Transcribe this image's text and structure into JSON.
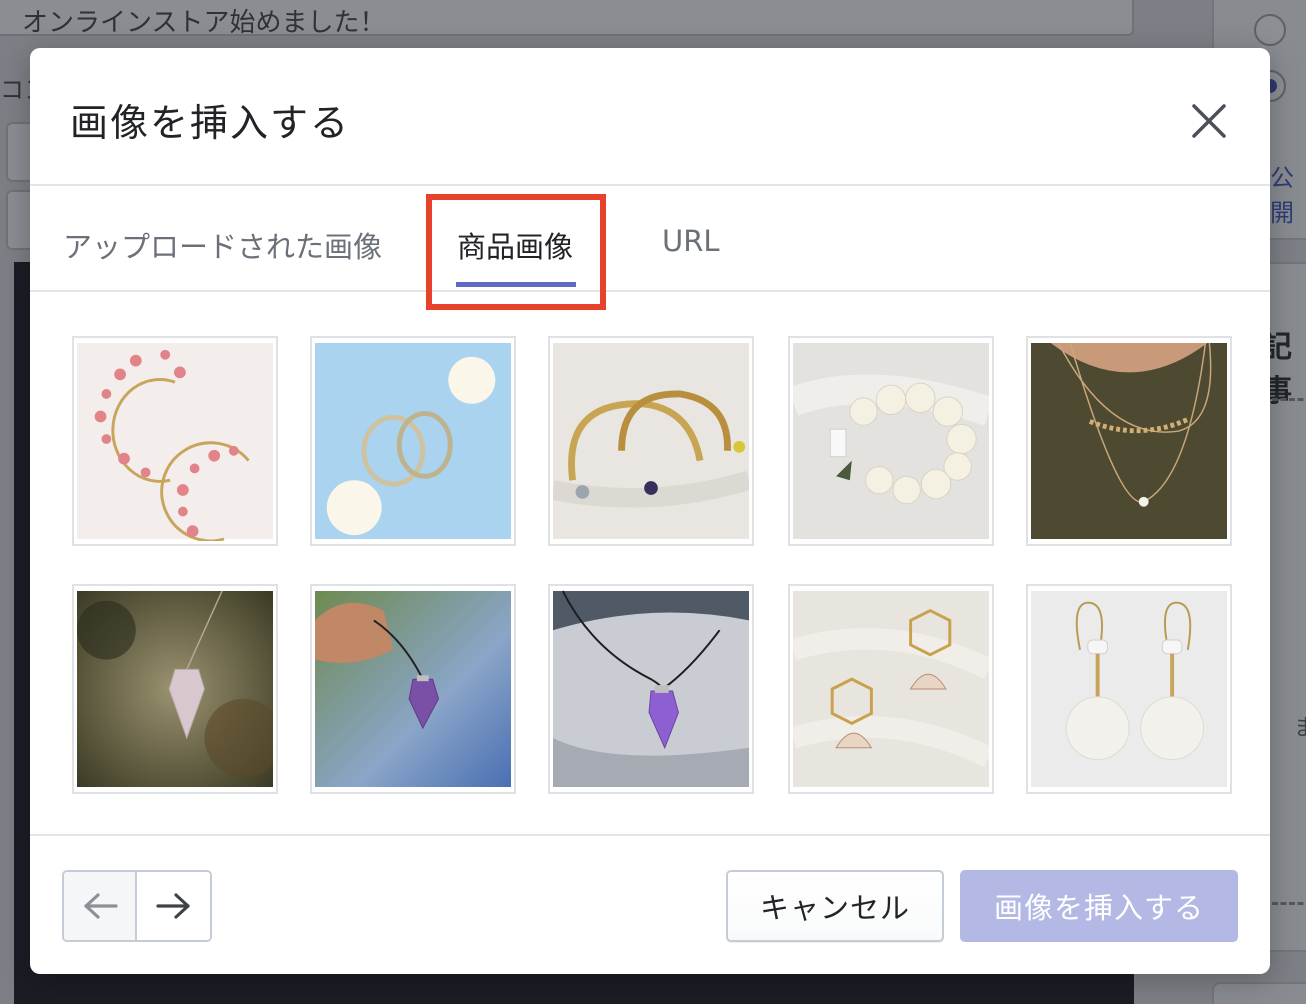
{
  "background": {
    "post_title": "オンラインストア始めました！",
    "content_label": "コン",
    "visibility_link": "公開",
    "article_heading": "記事",
    "side_text": "ま"
  },
  "modal": {
    "title": "画像を挿入する",
    "close_icon": "close-icon",
    "tabs": [
      {
        "label": "アップロードされた画像",
        "active": false
      },
      {
        "label": "商品画像",
        "active": true
      },
      {
        "label": "URL",
        "active": false
      }
    ],
    "highlight_color": "#e8412c",
    "accent_color": "#5c6ac4",
    "images": [
      {
        "name": "pink-flower-hoop-earrings"
      },
      {
        "name": "gold-hoop-earrings-blue-background"
      },
      {
        "name": "gold-cuff-bracelets-with-stones"
      },
      {
        "name": "white-bead-bracelet"
      },
      {
        "name": "layered-gold-necklace"
      },
      {
        "name": "crystal-pendulum"
      },
      {
        "name": "amethyst-pendant-in-hand"
      },
      {
        "name": "amethyst-pendant-on-stone"
      },
      {
        "name": "shell-hexagon-earrings"
      },
      {
        "name": "white-disc-drop-earrings"
      }
    ],
    "footer": {
      "prev_icon": "arrow-left-icon",
      "next_icon": "arrow-right-icon",
      "cancel_label": "キャンセル",
      "insert_label": "画像を挿入する",
      "insert_disabled": true
    }
  }
}
